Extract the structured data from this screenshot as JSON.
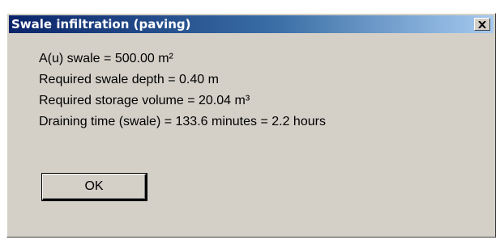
{
  "window": {
    "title": "Swale infiltration (paving)",
    "close_icon": "close-icon"
  },
  "results": {
    "lines": [
      "A(u) swale = 500.00 m²",
      "Required swale depth = 0.40 m",
      "Required storage volume = 20.04 m³",
      "Draining time (swale) = 133.6 minutes = 2.2 hours"
    ]
  },
  "buttons": {
    "ok_label": "OK"
  },
  "colors": {
    "title_bar_start": "#0a246a",
    "title_bar_end": "#a6caf0",
    "dialog_face": "#d4d0c8"
  }
}
